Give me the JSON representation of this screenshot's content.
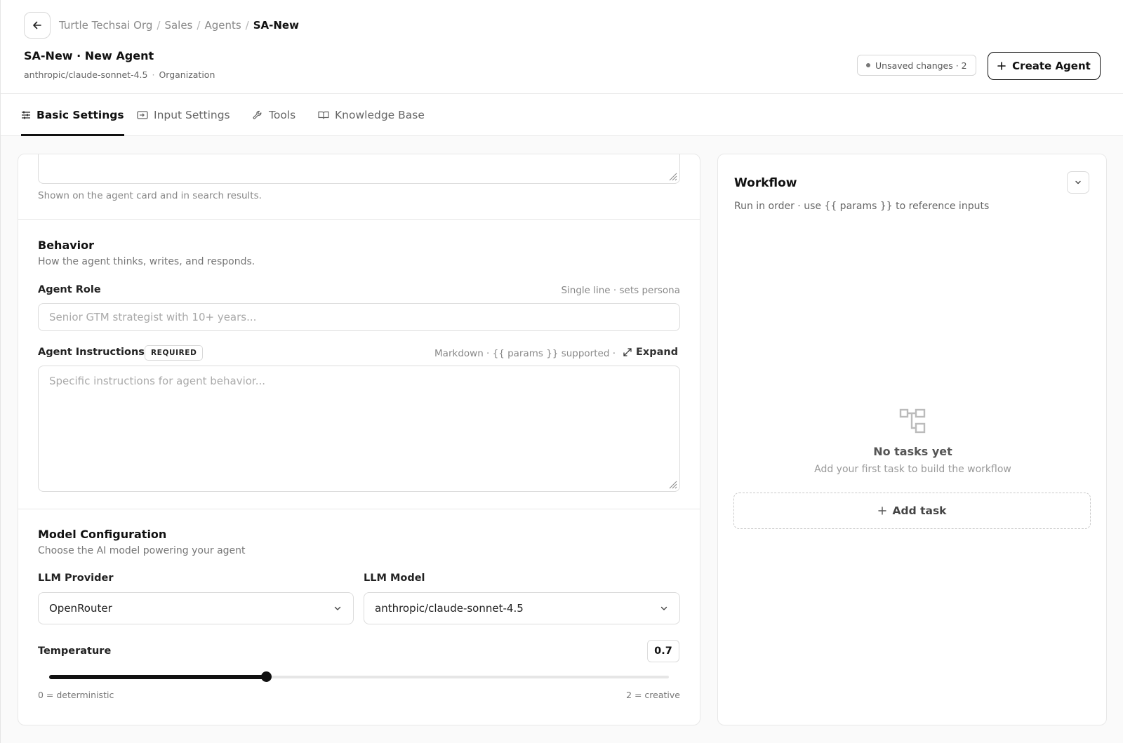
{
  "header": {
    "breadcrumb": [
      "Turtle Techsai Org",
      "Sales",
      "Agents",
      "SA-New"
    ],
    "title": "SA-New · New Agent",
    "model_id": "anthropic/claude-sonnet-4.5",
    "scope": "Organization",
    "unsaved_label": "Unsaved changes · 2",
    "create_label": "Create Agent",
    "create_icon": "plus-icon",
    "back_icon": "arrow-left-icon"
  },
  "tabs": [
    {
      "label": "Basic Settings",
      "icon": "sliders-icon",
      "active": true
    },
    {
      "label": "Input Settings",
      "icon": "input-icon",
      "active": false
    },
    {
      "label": "Tools",
      "icon": "wrench-icon",
      "active": false
    },
    {
      "label": "Knowledge Base",
      "icon": "book-icon",
      "active": false
    }
  ],
  "description": {
    "hint": "Shown on the agent card and in search results."
  },
  "behavior": {
    "title": "Behavior",
    "subtitle": "How the agent thinks, writes, and responds.",
    "role_label": "Agent Role",
    "role_meta": "Single line · sets persona",
    "role_placeholder": "Senior GTM strategist with 10+ years...",
    "instructions_label": "Agent Instructions",
    "required_badge": "REQUIRED",
    "instructions_meta": "Markdown · {{ params }} supported ·",
    "expand_label": "Expand",
    "instructions_placeholder": "Specific instructions for agent behavior..."
  },
  "model_config": {
    "title": "Model Configuration",
    "subtitle": "Choose the AI model powering your agent",
    "provider_label": "LLM Provider",
    "provider_value": "OpenRouter",
    "model_label": "LLM Model",
    "model_value": "anthropic/claude-sonnet-4.5",
    "temperature_label": "Temperature",
    "temperature_value": "0.7",
    "temperature_fraction": 0.35,
    "min_caption": "0 = deterministic",
    "max_caption": "2 = creative"
  },
  "workflow": {
    "title": "Workflow",
    "subtitle": "Run in order · use {{ params }} to reference inputs",
    "empty_title": "No tasks yet",
    "empty_subtitle": "Add your first task to build the workflow",
    "add_task_label": "Add task"
  }
}
